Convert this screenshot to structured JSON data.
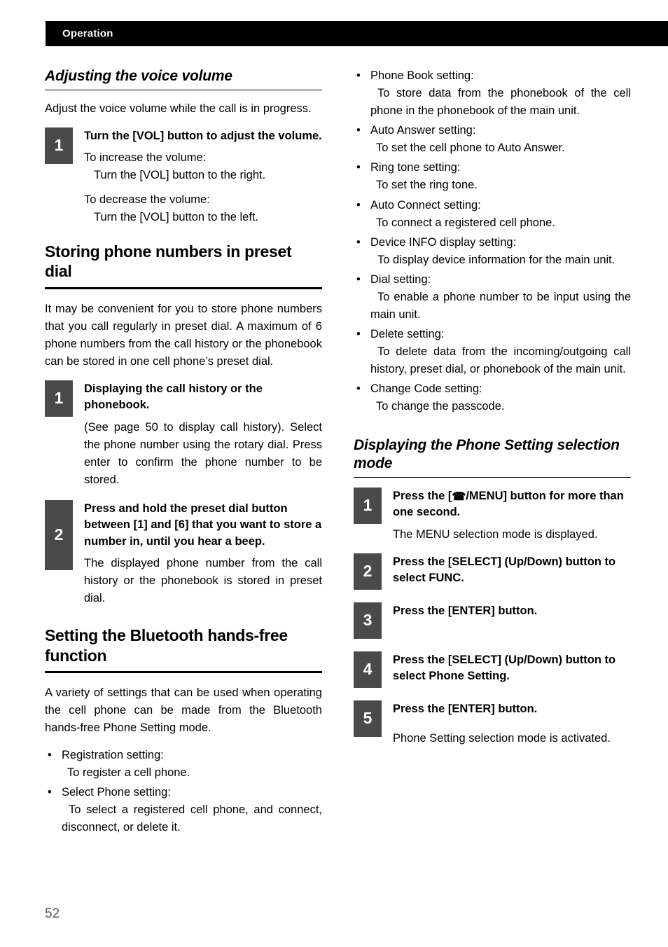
{
  "header": {
    "title": "Operation"
  },
  "page_number": "52",
  "icons": {
    "phone": "☎",
    "bullet": "•"
  },
  "left_column": {
    "section_voice_volume": {
      "heading": "Adjusting the voice volume",
      "intro": "Adjust the voice volume while the call is in progress.",
      "step1": {
        "number": "1",
        "title": "Turn the [VOL] button to adjust the volume.",
        "line1": "To increase the volume:",
        "line1_sub": "Turn the [VOL] button to the right.",
        "line2": "To decrease the volume:",
        "line2_sub": "Turn the [VOL] button to the left."
      }
    },
    "section_preset_dial": {
      "heading": "Storing phone numbers in preset dial",
      "intro": "It may be convenient for you to store phone numbers that you call regularly in preset dial. A maximum of 6 phone numbers from the call history or the phonebook can be stored in one cell phone’s preset dial.",
      "step1": {
        "number": "1",
        "title": "Displaying the call history or the phonebook.",
        "body": "(See page 50 to display call history). Select the phone number using the rotary dial. Press enter to confirm the phone number to be stored."
      },
      "step2": {
        "number": "2",
        "title": "Press and hold the preset dial button between [1] and [6] that you want to store a number in, until you hear a beep.",
        "body": "The displayed phone number from the call history or the phonebook is stored in preset dial."
      }
    },
    "section_bluetooth": {
      "heading": "Setting the Bluetooth hands-free function",
      "intro": "A variety of settings that can be used when operating the cell phone can be made from the Bluetooth hands-free Phone Setting mode.",
      "bullets": [
        {
          "label": "Registration setting:",
          "desc": "To register a cell phone."
        },
        {
          "label": "Select Phone setting:",
          "desc": "To select a registered cell phone, and connect, disconnect, or delete it."
        }
      ]
    }
  },
  "right_column": {
    "bullets": [
      {
        "label": "Phone Book setting:",
        "desc": "To store data from the phonebook of the cell phone in the phonebook of the main unit."
      },
      {
        "label": "Auto Answer setting:",
        "desc": "To set the cell phone to Auto Answer."
      },
      {
        "label": "Ring tone setting:",
        "desc": "To set the ring tone."
      },
      {
        "label": "Auto Connect setting:",
        "desc": "To connect a registered cell phone."
      },
      {
        "label": "Device INFO display setting:",
        "desc": "To display device information for the main unit."
      },
      {
        "label": "Dial setting:",
        "desc": "To enable a phone number to be input using the main unit."
      },
      {
        "label": "Delete setting:",
        "desc": "To delete data from the incoming/outgoing call history, preset dial, or phonebook of the main unit."
      },
      {
        "label": "Change Code setting:",
        "desc": "To change the passcode."
      }
    ],
    "section_phone_setting": {
      "heading": "Displaying the Phone Setting selection mode",
      "step1": {
        "number": "1",
        "title_before": "Press the [",
        "title_after": "/MENU] button for more than one second.",
        "body": "The MENU selection mode is displayed."
      },
      "step2": {
        "number": "2",
        "title": "Press the [SELECT] (Up/Down) button to select FUNC."
      },
      "step3": {
        "number": "3",
        "title": "Press the [ENTER] button."
      },
      "step4": {
        "number": "4",
        "title": "Press the [SELECT] (Up/Down) button to select Phone Setting."
      },
      "step5": {
        "number": "5",
        "title": "Press the [ENTER] button.",
        "body": "Phone Setting selection mode is activated."
      }
    }
  }
}
